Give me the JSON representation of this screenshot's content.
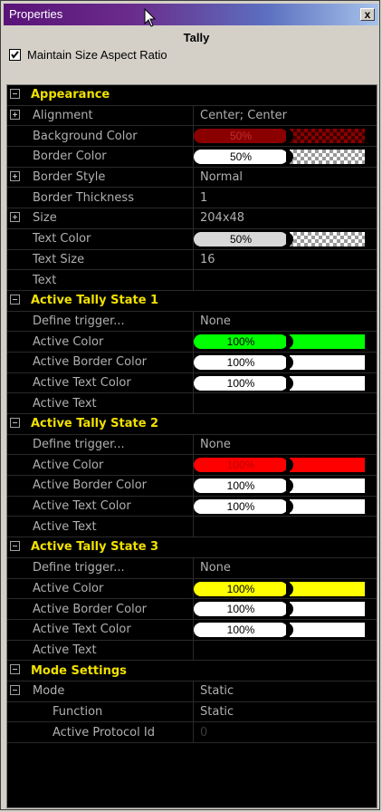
{
  "window": {
    "title": "Properties",
    "close_label": "x"
  },
  "header": {
    "title": "Tally"
  },
  "aspect": {
    "label": "Maintain Size Aspect Ratio",
    "checked": true
  },
  "sections": {
    "appearance": "Appearance",
    "state1": "Active Tally State 1",
    "state2": "Active Tally State 2",
    "state3": "Active Tally State 3",
    "mode": "Mode Settings"
  },
  "props": {
    "alignment": {
      "label": "Alignment",
      "value": "Center; Center"
    },
    "bg_color": {
      "label": "Background Color",
      "value": "50%"
    },
    "border_color": {
      "label": "Border Color",
      "value": "50%"
    },
    "border_style": {
      "label": "Border Style",
      "value": "Normal"
    },
    "border_thickness": {
      "label": "Border Thickness",
      "value": "1"
    },
    "size": {
      "label": "Size",
      "value": "204x48"
    },
    "text_color": {
      "label": "Text Color",
      "value": "50%"
    },
    "text_size": {
      "label": "Text Size",
      "value": "16"
    },
    "text": {
      "label": "Text",
      "value": ""
    }
  },
  "state1": {
    "trigger": {
      "label": "Define trigger...",
      "value": "None"
    },
    "active_color": {
      "label": "Active Color",
      "value": "100%"
    },
    "active_border": {
      "label": "Active Border Color",
      "value": "100%"
    },
    "active_text_color": {
      "label": "Active Text Color",
      "value": "100%"
    },
    "active_text": {
      "label": "Active Text",
      "value": ""
    }
  },
  "state2": {
    "trigger": {
      "label": "Define trigger...",
      "value": "None"
    },
    "active_color": {
      "label": "Active Color",
      "value": "100%"
    },
    "active_border": {
      "label": "Active Border Color",
      "value": "100%"
    },
    "active_text_color": {
      "label": "Active Text Color",
      "value": "100%"
    },
    "active_text": {
      "label": "Active Text",
      "value": ""
    }
  },
  "state3": {
    "trigger": {
      "label": "Define trigger...",
      "value": "None"
    },
    "active_color": {
      "label": "Active Color",
      "value": "100%"
    },
    "active_border": {
      "label": "Active Border Color",
      "value": "100%"
    },
    "active_text_color": {
      "label": "Active Text Color",
      "value": "100%"
    },
    "active_text": {
      "label": "Active Text",
      "value": ""
    }
  },
  "mode": {
    "mode": {
      "label": "Mode",
      "value": "Static"
    },
    "function": {
      "label": "Function",
      "value": "Static"
    },
    "protocol": {
      "label": "Active Protocol Id",
      "value": "0"
    }
  },
  "colors": {
    "title_gradient_start": "#5a1278",
    "title_gradient_end": "#a6c2ea",
    "section_text": "#f0e000",
    "grid_bg": "#000000",
    "state1_active": "#00ff00",
    "state2_active": "#ff0000",
    "state3_active": "#ffff00",
    "bg_color_swatch": "#8a0000"
  },
  "icons": {
    "cursor": "arrow-cursor-icon",
    "check": "checkmark-icon"
  }
}
